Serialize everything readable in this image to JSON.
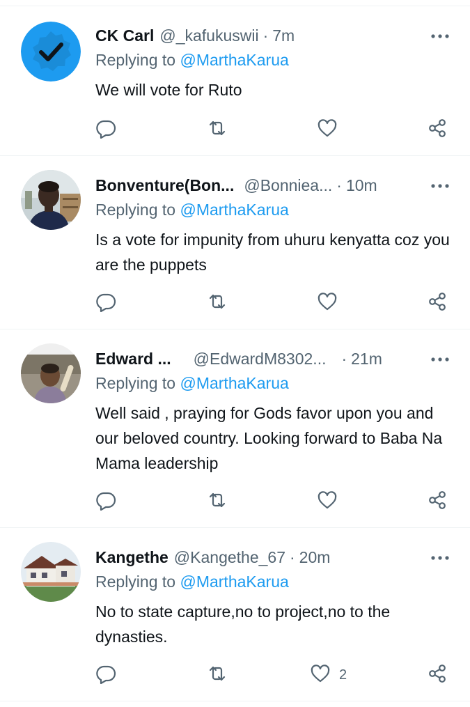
{
  "tweets": [
    {
      "name": "CK Carl",
      "handle": "@_kafukuswii",
      "time": "7m",
      "replying_prefix": "Replying to",
      "replying_to": "@MarthaKarua",
      "text": "We will vote for Ruto",
      "like_count": "",
      "avatar": "verified-badge-avatar"
    },
    {
      "name": "Bonventure(Bon...",
      "handle": "@Bonniea...",
      "time": "10m",
      "replying_prefix": "Replying to",
      "replying_to": "@MarthaKarua",
      "text": "Is a vote for impunity from uhuru kenyatta coz you are the puppets",
      "like_count": "",
      "avatar": "person-photo-avatar"
    },
    {
      "name": "Edward ...",
      "handle": "@EdwardM8302...",
      "time": "21m",
      "replying_prefix": "Replying to",
      "replying_to": "@MarthaKarua",
      "text": "Well said , praying for Gods favor upon you and our beloved country. Looking forward to Baba Na Mama leadership",
      "like_count": "",
      "avatar": "child-photo-avatar"
    },
    {
      "name": "Kangethe",
      "handle": "@Kangethe_67",
      "time": "20m",
      "replying_prefix": "Replying to",
      "replying_to": "@MarthaKarua",
      "text": "No to state capture,no to project,no to the dynasties.",
      "like_count": "2",
      "avatar": "house-photo-avatar"
    }
  ],
  "separator": "·",
  "icons": {
    "reply": "reply-icon",
    "retweet": "retweet-icon",
    "like": "heart-icon",
    "share": "share-icon",
    "more": "more-icon"
  },
  "colors": {
    "mention": "#1d9bf0",
    "secondary_text": "#536471",
    "primary_text": "#0f1419",
    "divider": "#eff3f4"
  }
}
